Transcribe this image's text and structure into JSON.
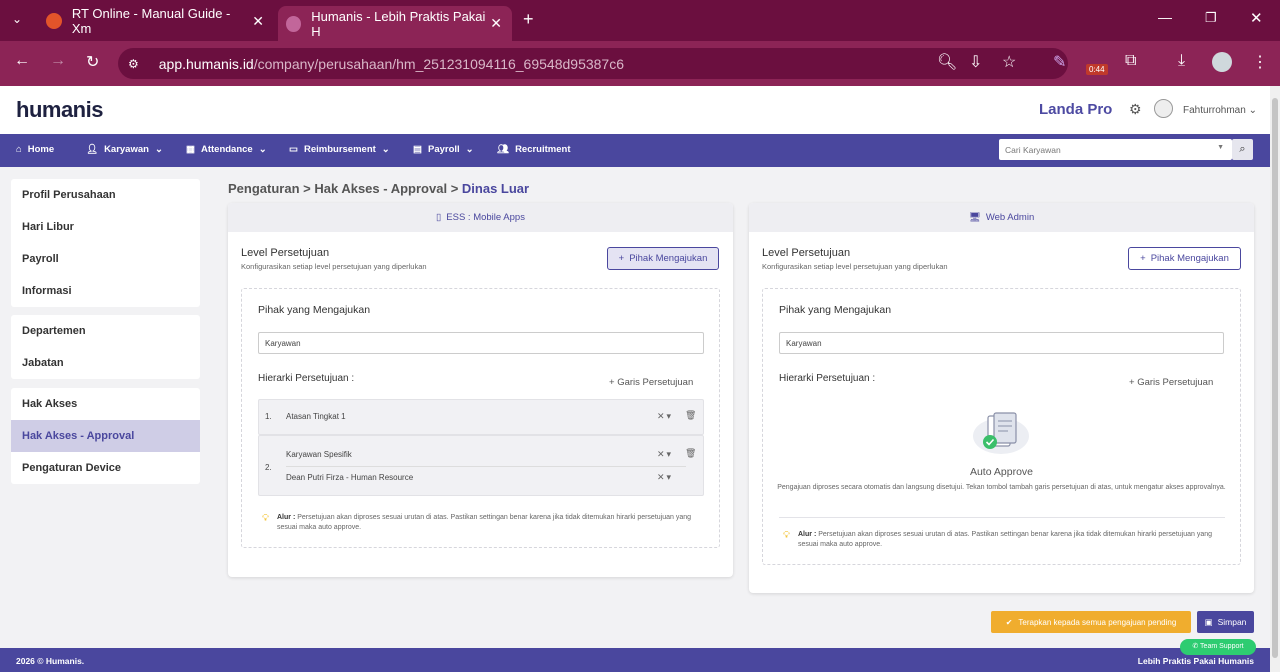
{
  "browser": {
    "tabs": [
      {
        "title": "RT Online - Manual Guide - Xm",
        "active": false
      },
      {
        "title": "Humanis - Lebih Praktis Pakai H",
        "active": true
      }
    ],
    "url_domain": "app.humanis.id",
    "url_path": "/company/perusahaan/hm_251231094116_69548d95387c6",
    "timer_badge": "0:44"
  },
  "header": {
    "logo": "humanis",
    "company": "Landa Pro",
    "user": "Fahturrohman"
  },
  "menu": {
    "items": [
      "Home",
      "Karyawan",
      "Attendance",
      "Reimbursement",
      "Payroll",
      "Recruitment"
    ],
    "search_placeholder": "Cari Karyawan"
  },
  "sidebar": {
    "group1": [
      "Profil Perusahaan",
      "Hari Libur",
      "Payroll",
      "Informasi"
    ],
    "group2": [
      "Departemen",
      "Jabatan"
    ],
    "group3": [
      "Hak Akses",
      "Hak Akses - Approval",
      "Pengaturan Device"
    ],
    "active": "Hak Akses - Approval"
  },
  "breadcrumb": {
    "part1": "Pengaturan",
    "part2": "Hak Akses - Approval",
    "current": "Dinas Luar",
    "sep": ">"
  },
  "ess": {
    "header": "ESS : Mobile Apps",
    "level_title": "Level Persetujuan",
    "level_sub": "Konfigurasikan setiap level persetujuan yang diperlukan",
    "add_btn": "Pihak Mengajukan",
    "pihak_label": "Pihak yang Mengajukan",
    "pihak_value": "Karyawan",
    "hierarki_label": "Hierarki Persetujuan :",
    "garis_btn": "Garis Persetujuan",
    "row1_no": "1.",
    "row1_value": "Atasan Tingkat 1",
    "row2_no": "2.",
    "row2_value1": "Karyawan Spesifik",
    "row2_value2": "Dean Putri Firza - Human Resource",
    "note_bold": "Alur :",
    "note_text": "Persetujuan akan diproses sesuai urutan di atas. Pastikan settingan benar karena jika tidak ditemukan hirarki persetujuan yang sesuai maka auto approve."
  },
  "web": {
    "header": "Web Admin",
    "level_title": "Level Persetujuan",
    "level_sub": "Konfigurasikan setiap level persetujuan yang diperlukan",
    "add_btn": "Pihak Mengajukan",
    "pihak_label": "Pihak yang Mengajukan",
    "pihak_value": "Karyawan",
    "hierarki_label": "Hierarki Persetujuan :",
    "garis_btn": "Garis Persetujuan",
    "auto_title": "Auto Approve",
    "auto_text": "Pengajuan diproses secara otomatis dan langsung disetujui. Tekan tombol tambah garis persetujuan di atas, untuk mengatur akses approvalnya.",
    "note_bold": "Alur :",
    "note_text": "Persetujuan akan diproses sesuai urutan di atas. Pastikan settingan benar karena jika tidak ditemukan hirarki persetujuan yang sesuai maka auto approve."
  },
  "actions": {
    "apply": "Terapkan kepada semua pengajuan pending",
    "save": "Simpan",
    "support": "Team Support"
  },
  "footer": {
    "left": "2026 © Humanis.",
    "right": "Lebih Praktis Pakai Humanis"
  },
  "colors": {
    "primary": "#4a479e",
    "browser": "#8c2456",
    "warning": "#f0ad2e",
    "support": "#2ecc71"
  }
}
